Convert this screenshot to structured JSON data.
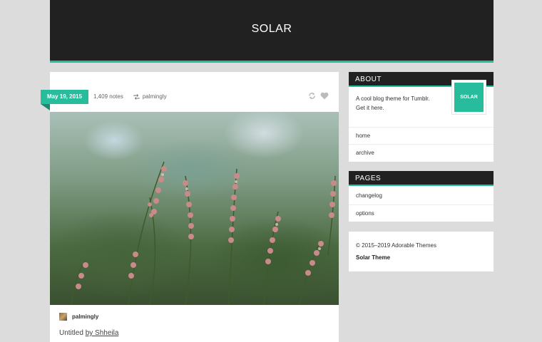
{
  "header": {
    "site_title": "SOLAR"
  },
  "post": {
    "date": "May 19, 2015",
    "notes": "1,409 notes",
    "reblogged_from": "palmingly",
    "author": "palmingly",
    "caption_prefix": "Untitled ",
    "caption_link": "by Shheila",
    "icons": [
      "reblog-icon",
      "heart-icon"
    ]
  },
  "sidebar": {
    "about": {
      "heading": "ABOUT",
      "description_line1": "A cool blog theme for Tumblr.",
      "description_line2": "Get it here.",
      "badge": "SOLAR",
      "links": [
        "home",
        "archive"
      ]
    },
    "pages": {
      "heading": "PAGES",
      "links": [
        "changelog",
        "options"
      ]
    },
    "footer": {
      "copyright": "© 2015–2019 Adorable Themes",
      "theme": "Solar Theme"
    }
  },
  "colors": {
    "accent": "#27bc9c",
    "header_bg": "#212121",
    "page_bg": "#dcdcdc"
  }
}
